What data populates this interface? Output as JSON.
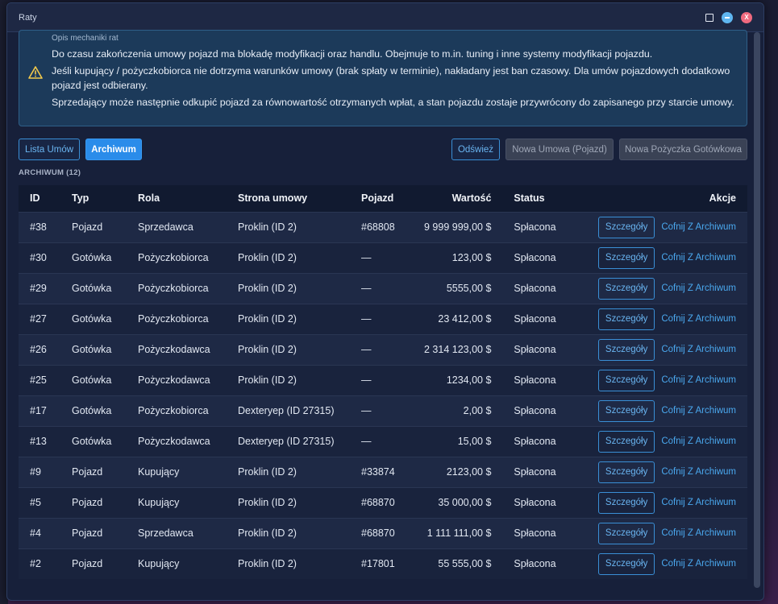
{
  "window": {
    "title": "Raty"
  },
  "info": {
    "title": "Opis mechaniki rat",
    "lines": [
      "Do czasu zakończenia umowy pojazd ma blokadę modyfikacji oraz handlu. Obejmuje to m.in. tuning i inne systemy modyfikacji pojazdu.",
      "Jeśli kupujący / pożyczkobiorca nie dotrzyma warunków umowy (brak spłaty w terminie), nakładany jest ban czasowy. Dla umów pojazdowych dodatkowo pojazd jest odbierany.",
      "Sprzedający może następnie odkupić pojazd za równowartość otrzymanych wpłat, a stan pojazdu zostaje przywrócony do zapisanego przy starcie umowy."
    ]
  },
  "toolbar": {
    "list_label": "Lista Umów",
    "archive_label": "Archiwum",
    "refresh_label": "Odśwież",
    "new_vehicle_label": "Nowa Umowa (Pojazd)",
    "new_cash_label": "Nowa Pożyczka Gotówkowa"
  },
  "section_label": "ARCHIWUM (12)",
  "table": {
    "headers": [
      "ID",
      "Typ",
      "Rola",
      "Strona umowy",
      "Pojazd",
      "Wartość",
      "Status",
      "Akcje"
    ],
    "details_label": "Szczegóły",
    "restore_label": "Cofnij Z Archiwum",
    "rows": [
      [
        "#38",
        "Pojazd",
        "Sprzedawca",
        "Proklin (ID 2)",
        "#68808",
        "9 999 999,00 $",
        "Spłacona"
      ],
      [
        "#30",
        "Gotówka",
        "Pożyczkobiorca",
        "Proklin (ID 2)",
        "—",
        "123,00 $",
        "Spłacona"
      ],
      [
        "#29",
        "Gotówka",
        "Pożyczkobiorca",
        "Proklin (ID 2)",
        "—",
        "5555,00 $",
        "Spłacona"
      ],
      [
        "#27",
        "Gotówka",
        "Pożyczkobiorca",
        "Proklin (ID 2)",
        "—",
        "23 412,00 $",
        "Spłacona"
      ],
      [
        "#26",
        "Gotówka",
        "Pożyczkodawca",
        "Proklin (ID 2)",
        "—",
        "2 314 123,00 $",
        "Spłacona"
      ],
      [
        "#25",
        "Gotówka",
        "Pożyczkodawca",
        "Proklin (ID 2)",
        "—",
        "1234,00 $",
        "Spłacona"
      ],
      [
        "#17",
        "Gotówka",
        "Pożyczkobiorca",
        "Dexteryep (ID 27315)",
        "—",
        "2,00 $",
        "Spłacona"
      ],
      [
        "#13",
        "Gotówka",
        "Pożyczkodawca",
        "Dexteryep (ID 27315)",
        "—",
        "15,00 $",
        "Spłacona"
      ],
      [
        "#9",
        "Pojazd",
        "Kupujący",
        "Proklin (ID 2)",
        "#33874",
        "2123,00 $",
        "Spłacona"
      ],
      [
        "#5",
        "Pojazd",
        "Kupujący",
        "Proklin (ID 2)",
        "#68870",
        "35 000,00 $",
        "Spłacona"
      ],
      [
        "#4",
        "Pojazd",
        "Sprzedawca",
        "Proklin (ID 2)",
        "#68870",
        "1 111 111,00 $",
        "Spłacona"
      ],
      [
        "#2",
        "Pojazd",
        "Kupujący",
        "Proklin (ID 2)",
        "#17801",
        "55 555,00 $",
        "Spłacona"
      ]
    ]
  },
  "colors": {
    "accent": "#2a8cea",
    "link": "#4aa8ee",
    "info_bg": "#1c3a5a",
    "warning": "#f2c94c"
  },
  "icons": [
    "maximize-icon",
    "minimize-icon",
    "close-icon",
    "warning-icon"
  ]
}
